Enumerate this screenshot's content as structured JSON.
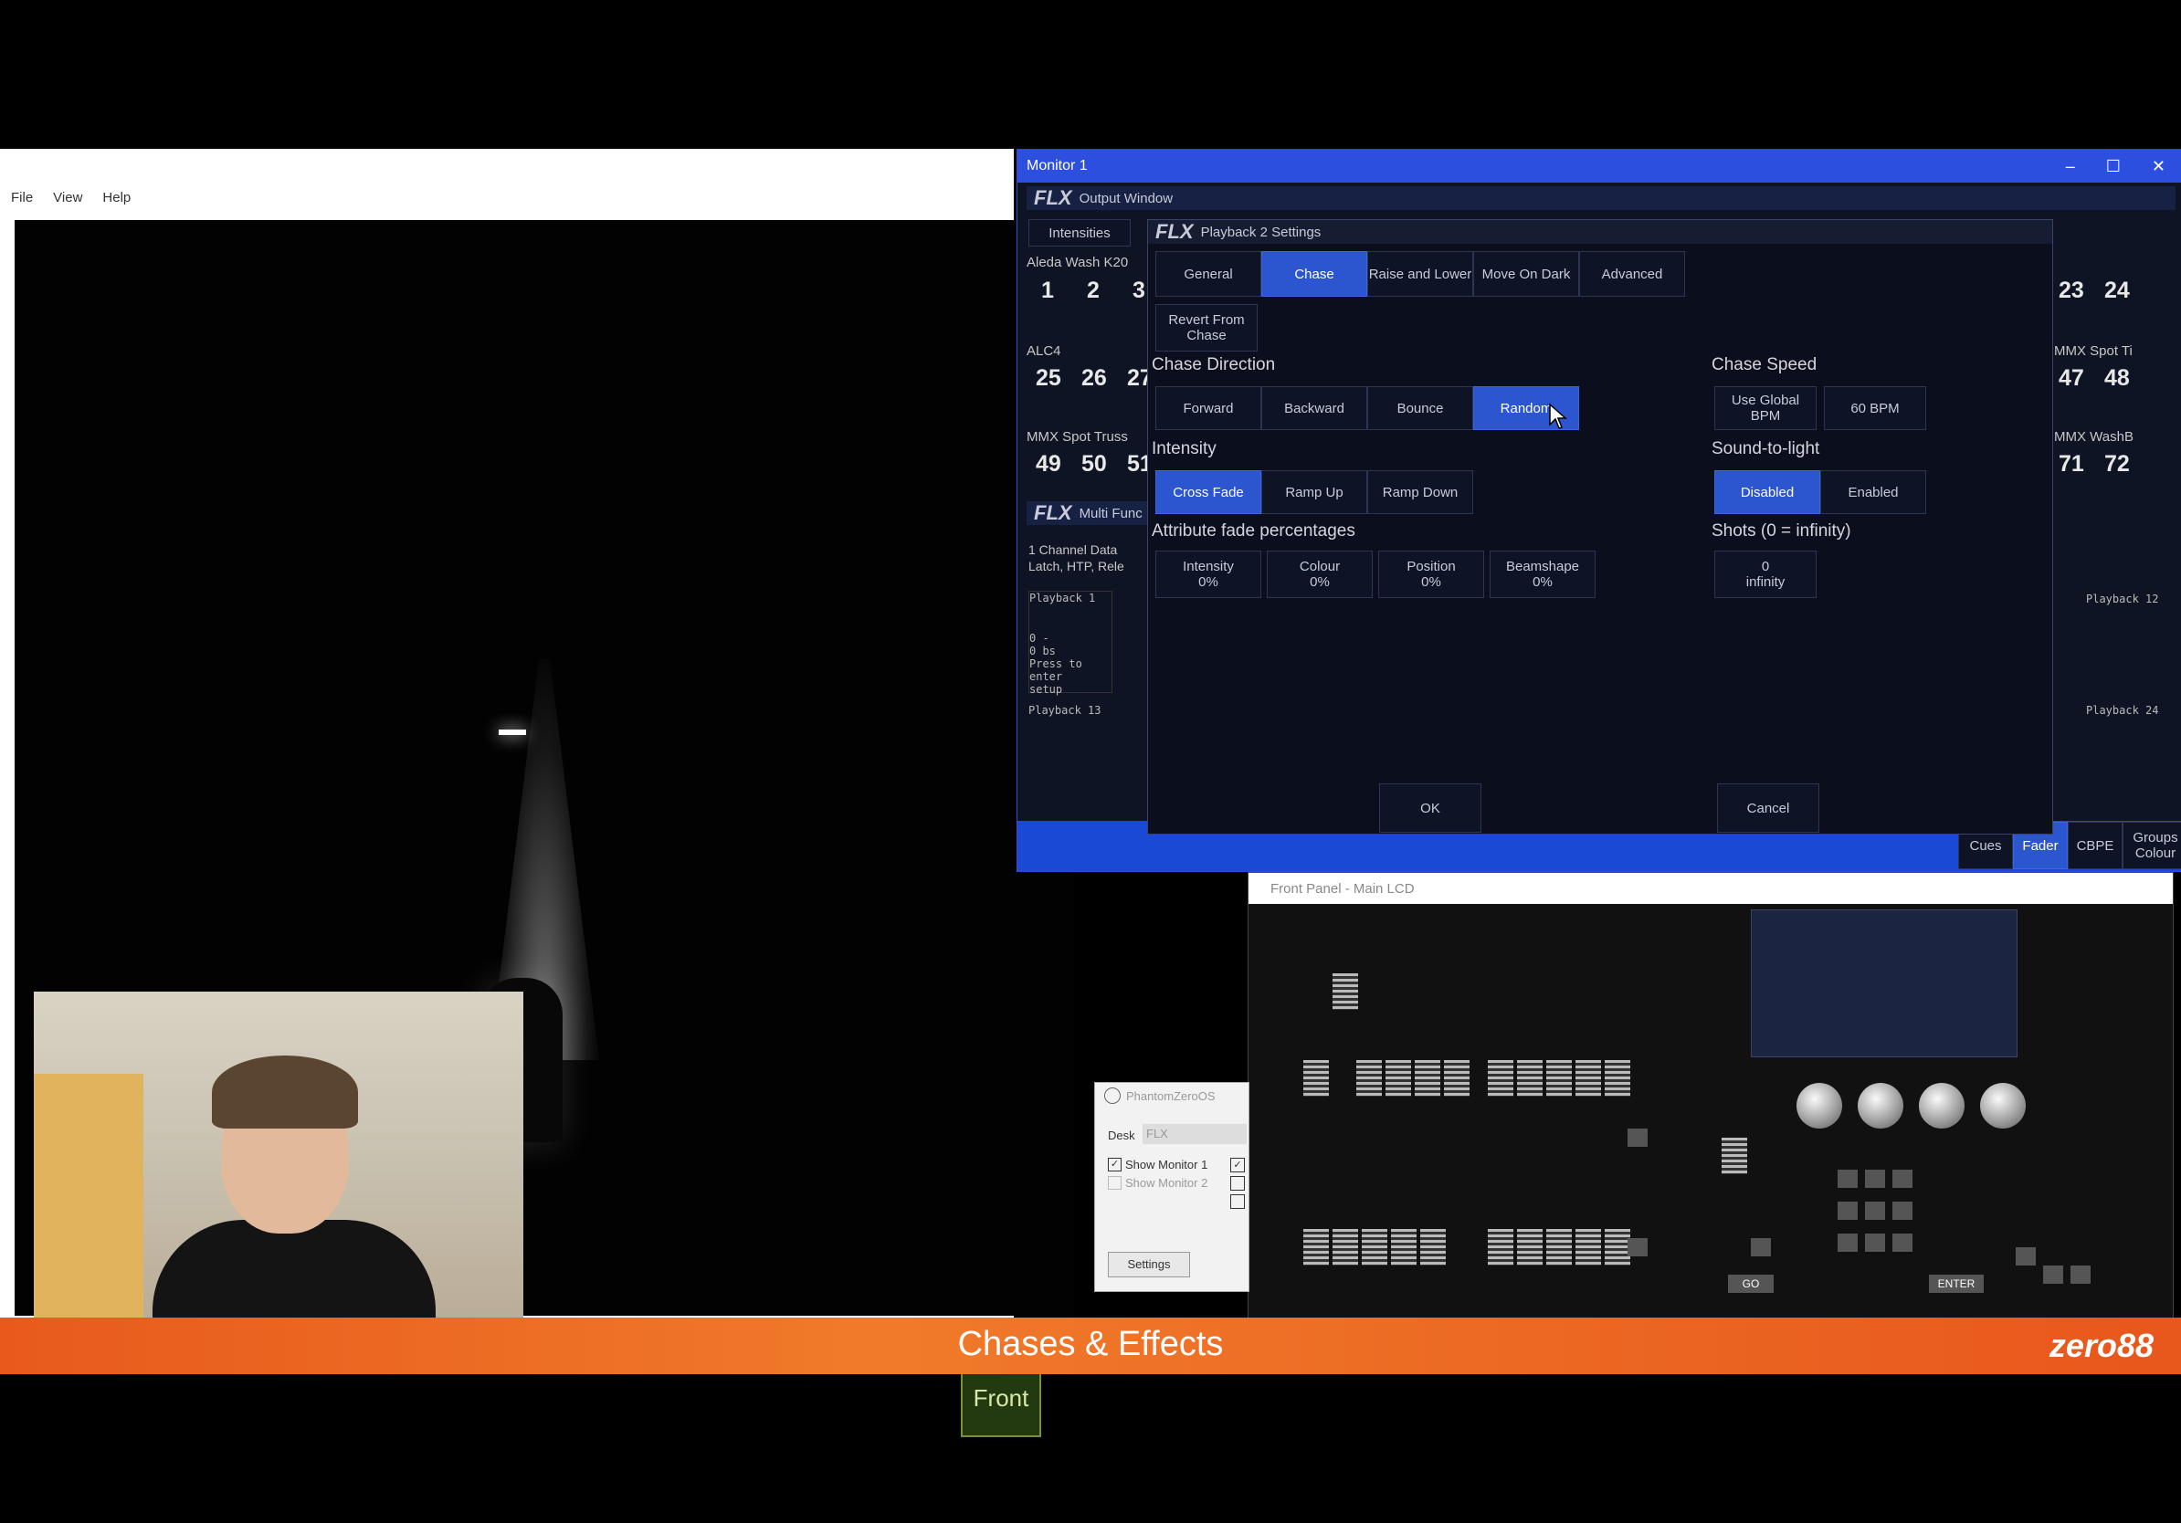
{
  "visualiser": {
    "menu": [
      "File",
      "View",
      "Help"
    ],
    "front_button": "Front"
  },
  "monitor1": {
    "title": "Monitor 1",
    "output_window": "Output Window",
    "flx": "FLX",
    "intensities_tab": "Intensities",
    "left_groups": [
      {
        "label": "Aleda Wash K20",
        "nums": [
          "1",
          "2",
          "3"
        ]
      },
      {
        "label": "ALC4",
        "nums": [
          "25",
          "26",
          "27"
        ]
      },
      {
        "label": "MMX Spot Truss",
        "nums": [
          "49",
          "50",
          "51"
        ]
      }
    ],
    "right_groups": [
      {
        "label": "",
        "nums": [
          "23",
          "24"
        ]
      },
      {
        "label": "MMX Spot Ti",
        "nums": [
          "47",
          "48"
        ]
      },
      {
        "label": "MMX WashB",
        "nums": [
          "71",
          "72"
        ]
      }
    ],
    "multi_func": "Multi Func",
    "channel_data": "1 Channel Data",
    "latch_text": "Latch, HTP, Rele",
    "playback1": "Playback 1",
    "playback1_text": [
      "0 -",
      "0 bs",
      "Press to enter",
      "setup"
    ],
    "playback13": "Playback 13",
    "playback12": "Playback 12",
    "playback24": "Playback 24",
    "bottom_tabs": [
      "Cues",
      "Fader",
      "CBPE",
      "Groups Colour"
    ]
  },
  "dialog": {
    "title": "Playback 2 Settings",
    "tabs": [
      "General",
      "Chase",
      "Raise and Lower",
      "Move On Dark",
      "Advanced"
    ],
    "revert": "Revert From Chase",
    "chase_direction": "Chase Direction",
    "directions": [
      "Forward",
      "Backward",
      "Bounce",
      "Random"
    ],
    "intensity": "Intensity",
    "intensity_opts": [
      "Cross Fade",
      "Ramp Up",
      "Ramp Down"
    ],
    "attr_fade": "Attribute fade percentages",
    "attr_opts": [
      {
        "name": "Intensity",
        "val": "0%"
      },
      {
        "name": "Colour",
        "val": "0%"
      },
      {
        "name": "Position",
        "val": "0%"
      },
      {
        "name": "Beamshape",
        "val": "0%"
      }
    ],
    "chase_speed": "Chase Speed",
    "speed_opts": [
      "Use Global BPM",
      "60 BPM"
    ],
    "sound": "Sound-to-light",
    "sound_opts": [
      "Disabled",
      "Enabled"
    ],
    "shots": "Shots (0 = infinity)",
    "shots_val": "0",
    "shots_sub": "infinity",
    "ok": "OK",
    "cancel": "Cancel"
  },
  "front_panel": {
    "title": "Front Panel - Main LCD",
    "go": "GO",
    "enter": "ENTER"
  },
  "phantom": {
    "title": "PhantomZeroOS",
    "desk_label": "Desk",
    "desk_value": "FLX",
    "show_monitor_1": "Show Monitor 1",
    "show_monitor_2": "Show Monitor 2",
    "settings": "Settings"
  },
  "banner": {
    "title": "Chases & Effects",
    "logo": "zero88"
  }
}
